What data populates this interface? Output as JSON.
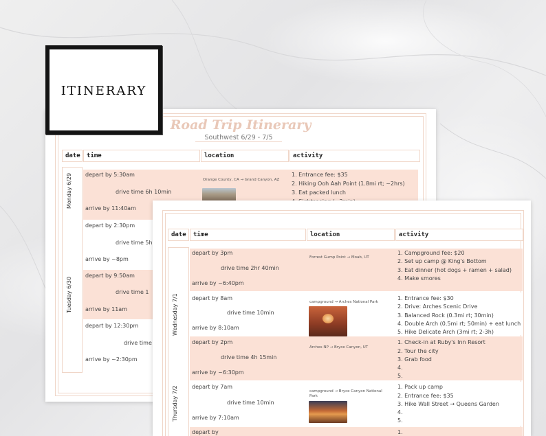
{
  "badge": {
    "title": "ITINERARY"
  },
  "back_sheet": {
    "title": "Road Trip Itinerary",
    "subtitle": "Southwest 6/29 - 7/5",
    "headers": {
      "date": "date",
      "time": "time",
      "location": "location",
      "activity": "activity"
    },
    "days": [
      "Monday 6/29",
      "Tuesday 6/30"
    ],
    "rows": [
      {
        "depart": "depart by 5:30am",
        "drive": "drive time 6h 10min",
        "arrive": "arrive by 11:40am",
        "location": "Orange County, CA → Grand Canyon, AZ",
        "activities": [
          "1.  Entrance fee: $35",
          "2.  Hiking Ooh Aah Point (1.8mi rt; ~2hrs)",
          "3.  Eat packed lunch",
          "4.  Sightseeing (~2min)"
        ]
      },
      {
        "depart": "depart by 2:30pm",
        "drive": "drive time 5h",
        "arrive": "arrive by ~8pm"
      },
      {
        "depart": "depart by 9:50am",
        "drive": "drive time 1",
        "arrive": "arrive by 11am"
      },
      {
        "depart": "depart by 12:30pm",
        "drive": "drive time",
        "arrive": "arrive by ~2:30pm"
      }
    ]
  },
  "front_sheet": {
    "headers": {
      "date": "date",
      "time": "time",
      "location": "location",
      "activity": "activity"
    },
    "days": [
      "Wednesday 7/1",
      "Thursday 7/2"
    ],
    "rows": [
      {
        "depart": "depart by 3pm",
        "drive": "drive time 2hr 40min",
        "arrive": "arrive by ~6:40pm",
        "location": "Forrest Gump Point → Moab, UT",
        "activities": [
          "1.  Campground fee: $20",
          "2.  Set up camp @ King's Bottom",
          "3.  Eat dinner (hot dogs + ramen + salad)",
          "4.  Make smores"
        ]
      },
      {
        "depart": "depart by 8am",
        "drive": "drive time 10min",
        "arrive": "arrive by 8:10am",
        "location": "campground → Arches National Park",
        "activities": [
          "1.  Entrance fee: $30",
          "2.  Drive: Arches Scenic Drive",
          "3.  Balanced Rock (0.3mi rt; 30min)",
          "4.  Double Arch (0.5mi rt; 50min) + eat lunch",
          "5.  Hike Delicate Arch (3mi rt; 2-3h)"
        ]
      },
      {
        "depart": "depart by 2pm",
        "drive": "drive time 4h 15min",
        "arrive": "arrive by ~6:30pm",
        "location": "Arches NP → Bryce Canyon, UT",
        "activities": [
          "1.  Check-in at Ruby's Inn Resort",
          "2.  Tour the city",
          "3.  Grab food",
          "4.",
          "5."
        ]
      },
      {
        "depart": "depart by 7am",
        "drive": "drive time 10min",
        "arrive": "arrive by 7:10am",
        "location": "campground → Bryce Canyon National Park",
        "activities": [
          "1.  Pack up camp",
          "2.  Entrance fee: $35",
          "3.  Hike Wall Street → Queens Garden",
          "4.",
          "5."
        ]
      },
      {
        "depart": "depart by",
        "activities": [
          "1."
        ]
      }
    ]
  }
}
